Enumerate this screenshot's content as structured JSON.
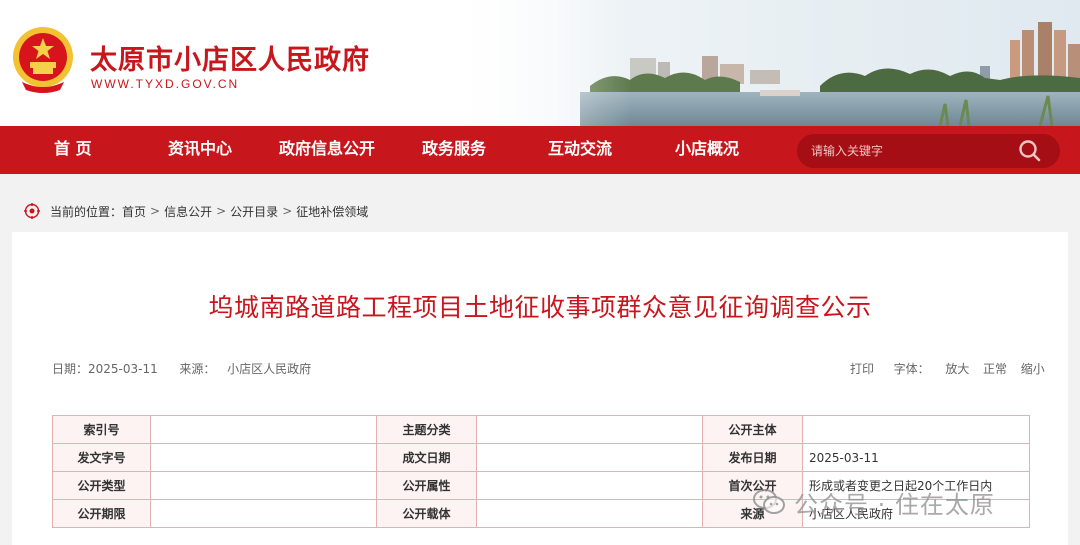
{
  "header": {
    "site_title": "太原市小店区人民政府",
    "site_domain": "WWW.TYXD.GOV.CN"
  },
  "nav": {
    "items": [
      {
        "label": "首 页"
      },
      {
        "label": "资讯中心"
      },
      {
        "label": "政府信息公开"
      },
      {
        "label": "政务服务"
      },
      {
        "label": "互动交流"
      },
      {
        "label": "小店概况"
      }
    ],
    "search_placeholder": "请输入关键字"
  },
  "breadcrumb": {
    "prefix": "当前的位置：",
    "items": [
      "首页",
      "信息公开",
      "公开目录",
      "征地补偿领域"
    ],
    "separator": ">"
  },
  "article": {
    "title": "坞城南路道路工程项目土地征收事项群众意见征询调查公示",
    "date_label": "日期：",
    "date": "2025-03-11",
    "source_label": "来源：",
    "source": "小店区人民政府",
    "print_label": "打印",
    "font_label": "字体：",
    "font_large": "放大",
    "font_normal": "正常",
    "font_small": "缩小"
  },
  "info_table": {
    "rows": [
      [
        {
          "label": "索引号",
          "value": ""
        },
        {
          "label": "主题分类",
          "value": ""
        },
        {
          "label": "公开主体",
          "value": ""
        }
      ],
      [
        {
          "label": "发文字号",
          "value": ""
        },
        {
          "label": "成文日期",
          "value": ""
        },
        {
          "label": "发布日期",
          "value": "2025-03-11"
        }
      ],
      [
        {
          "label": "公开类型",
          "value": ""
        },
        {
          "label": "公开属性",
          "value": ""
        },
        {
          "label": "首次公开",
          "value": "形成或者变更之日起20个工作日内"
        }
      ],
      [
        {
          "label": "公开期限",
          "value": ""
        },
        {
          "label": "公开载体",
          "value": ""
        },
        {
          "label": "来源",
          "value": "小店区人民政府"
        }
      ]
    ]
  },
  "watermark": {
    "text": "公众号 · 住在太原"
  },
  "colors": {
    "brand_red": "#c8161d",
    "search_bg": "#a50e14",
    "table_border": "#e3b1b1"
  },
  "icons": {
    "emblem": "national-emblem-icon",
    "search": "search-icon",
    "location": "location-pin-icon",
    "watermark": "wechat-icon"
  }
}
